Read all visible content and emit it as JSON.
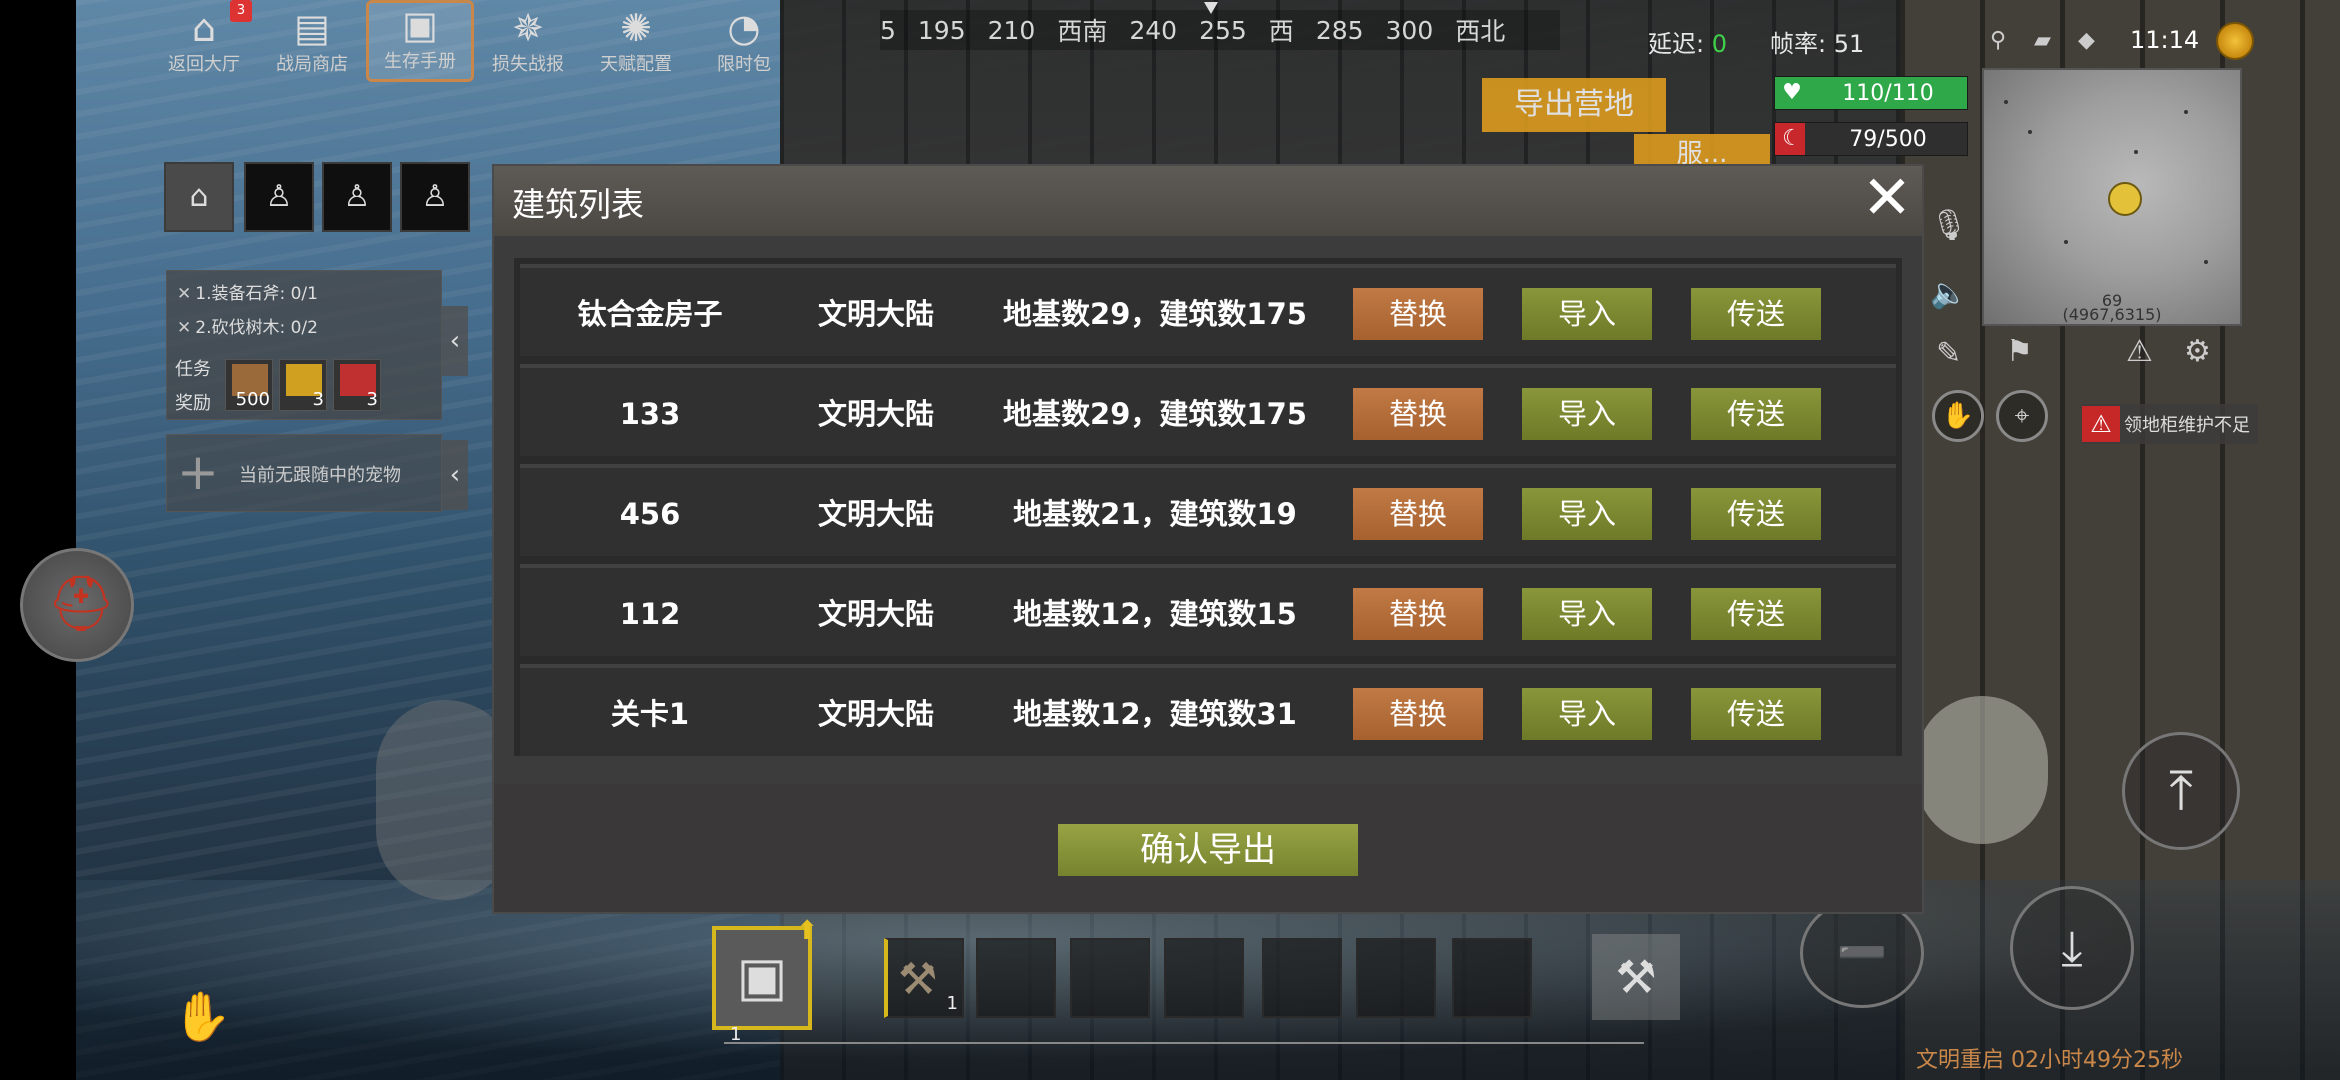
{
  "top_menu": {
    "items": [
      {
        "label": "返回大厅",
        "icon": "home-icon",
        "glyph": "⌂",
        "badge": "3"
      },
      {
        "label": "战局商店",
        "icon": "shop-icon",
        "glyph": "▤"
      },
      {
        "label": "生存手册",
        "icon": "book-icon",
        "glyph": "▣",
        "active": true
      },
      {
        "label": "损失战报",
        "icon": "explosion-icon",
        "glyph": "✵"
      },
      {
        "label": "天赋配置",
        "icon": "talent-icon",
        "glyph": "✺"
      },
      {
        "label": "限时包",
        "icon": "clock-icon",
        "glyph": "◔"
      }
    ]
  },
  "compass": {
    "ticks": [
      "5",
      "195",
      "210",
      "西南",
      "240",
      "255",
      "西",
      "285",
      "300",
      "西北"
    ]
  },
  "status": {
    "latency_label": "延迟:",
    "latency_value": "0",
    "fps_label": "帧率:",
    "fps_value": "51",
    "time": "11:14"
  },
  "export_camp_label": "导出营地",
  "orange_tab_label": "服...",
  "bars": {
    "health": {
      "text": "110/110",
      "fraction": 1.0,
      "color": "#2fa84a",
      "icon": "heart-icon",
      "glyph": "♥"
    },
    "hunger": {
      "text": "79/500",
      "fraction": 0.158,
      "color": "#c8282c",
      "icon": "moon-icon",
      "glyph": "☾"
    }
  },
  "minimap": {
    "number": "69",
    "coord": "(4967,6315)"
  },
  "warning_text": "领地柜维护不足",
  "tasks": {
    "items": [
      {
        "text": "1.装备石斧: 0/1"
      },
      {
        "text": "2.砍伐树木: 0/2"
      }
    ],
    "label_task": "任务",
    "label_reward": "奖励",
    "rewards": [
      {
        "icon": "wood-icon",
        "count": "500",
        "color": "#9a6a3a"
      },
      {
        "icon": "bottle-icon",
        "count": "3",
        "color": "#d0a020"
      },
      {
        "icon": "meat-icon",
        "count": "3",
        "color": "#c03030"
      }
    ]
  },
  "pet_panel_text": "当前无跟随中的宠物",
  "hotbar": {
    "backpack_count": "1",
    "slot1_count": "1"
  },
  "restart_text": "文明重启 02小时49分25秒",
  "dialog": {
    "title": "建筑列表",
    "rows": [
      {
        "name": "钛合金房子",
        "region": "文明大陆",
        "info": "地基数29，建筑数175"
      },
      {
        "name": "133",
        "region": "文明大陆",
        "info": "地基数29，建筑数175"
      },
      {
        "name": "456",
        "region": "文明大陆",
        "info": "地基数21，建筑数19"
      },
      {
        "name": "112",
        "region": "文明大陆",
        "info": "地基数12，建筑数15"
      },
      {
        "name": "关卡1",
        "region": "文明大陆",
        "info": "地基数12，建筑数31"
      }
    ],
    "btn_replace": "替换",
    "btn_import": "导入",
    "btn_send": "传送",
    "confirm_label": "确认导出"
  }
}
